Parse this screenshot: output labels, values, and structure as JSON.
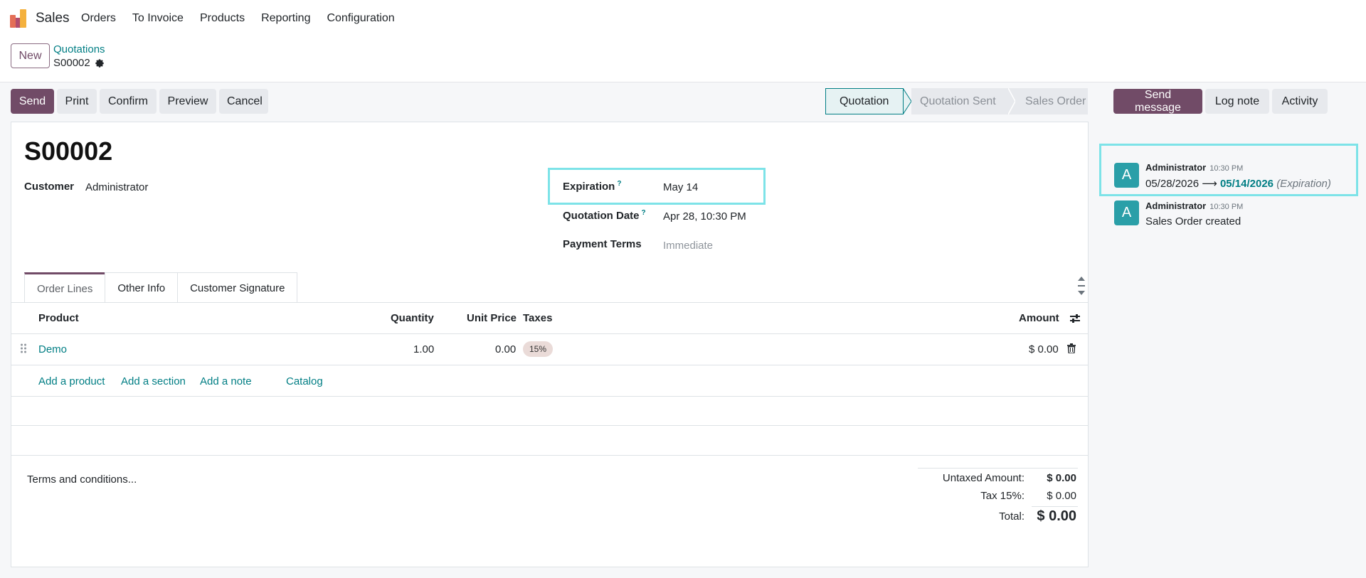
{
  "app": {
    "name": "Sales"
  },
  "menu": [
    "Orders",
    "To Invoice",
    "Products",
    "Reporting",
    "Configuration"
  ],
  "control": {
    "new_label": "New",
    "breadcrumb_parent": "Quotations",
    "breadcrumb_current": "S00002"
  },
  "actions": {
    "send": "Send",
    "print": "Print",
    "confirm": "Confirm",
    "preview": "Preview",
    "cancel": "Cancel"
  },
  "statusbar": {
    "stages": [
      "Quotation",
      "Quotation Sent",
      "Sales Order"
    ],
    "active": "Quotation"
  },
  "form": {
    "name": "S00002",
    "customer_label": "Customer",
    "customer_value": "Administrator",
    "expiration_label": "Expiration",
    "expiration_help": "?",
    "expiration_value": "May 14",
    "quotation_date_label": "Quotation Date",
    "quotation_date_help": "?",
    "quotation_date_value": "Apr 28, 10:30 PM",
    "payment_terms_label": "Payment Terms",
    "payment_terms_placeholder": "Immediate"
  },
  "tabs": [
    "Order Lines",
    "Other Info",
    "Customer Signature"
  ],
  "table": {
    "headers": {
      "product": "Product",
      "quantity": "Quantity",
      "unit_price": "Unit Price",
      "taxes": "Taxes",
      "amount": "Amount"
    },
    "rows": [
      {
        "product": "Demo",
        "quantity": "1.00",
        "unit_price": "0.00",
        "taxes": "15%",
        "amount": "$ 0.00"
      }
    ],
    "add_product": "Add a product",
    "add_section": "Add a section",
    "add_note": "Add a note",
    "catalog": "Catalog"
  },
  "terms_placeholder": "Terms and conditions...",
  "totals": {
    "untaxed_label": "Untaxed Amount:",
    "untaxed_value": "$ 0.00",
    "tax_label": "Tax 15%:",
    "tax_value": "$ 0.00",
    "total_label": "Total:",
    "total_value": "$ 0.00"
  },
  "chatter": {
    "send_message": "Send message",
    "log_note": "Log note",
    "activity": "Activity",
    "messages": [
      {
        "avatar": "A",
        "author": "Administrator",
        "time": "10:30 PM",
        "old_value": "05/28/2026",
        "arrow": "⟶",
        "new_value": "05/14/2026",
        "field": "(Expiration)"
      },
      {
        "avatar": "A",
        "author": "Administrator",
        "time": "10:30 PM",
        "body": "Sales Order created"
      }
    ]
  },
  "colors": {
    "brand": "#714B67",
    "link": "#017e84",
    "avatar": "#2a9fa8",
    "highlight": "#7de3e8"
  }
}
